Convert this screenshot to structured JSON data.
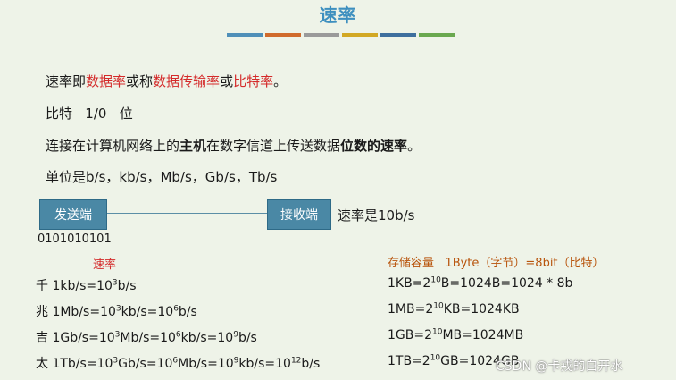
{
  "slide": {
    "title": "速率",
    "title_bar_colors": [
      "#4f8fb8",
      "#d06a2c",
      "#9a9a9a",
      "#d2a824",
      "#3e6f9e",
      "#6aa84f"
    ]
  },
  "intro": {
    "p1": [
      "速率即",
      "数据率",
      "或称",
      "数据传输率",
      "或",
      "比特率",
      "。"
    ],
    "p2": "比特   1/0   位",
    "p3": [
      "连接在计算机网络上的",
      "主机",
      "在数字信道上传送数据",
      "位数的速率",
      "。"
    ],
    "p4": "单位是b/s，kb/s，Mb/s，Gb/s，Tb/s"
  },
  "diagram": {
    "sender": "发送端",
    "receiver": "接收端",
    "rate_text": "速率是10b/s",
    "bits": "0101010101"
  },
  "rate_col": {
    "header": "速率",
    "rows": [
      [
        "千 1kb/s=10",
        "3",
        "b/s"
      ],
      [
        "兆 1Mb/s=10",
        "3",
        "kb/s=10",
        "6",
        "b/s"
      ],
      [
        "吉 1Gb/s=10",
        "3",
        "Mb/s=10",
        "6",
        "kb/s=10",
        "9",
        "b/s"
      ],
      [
        "太 1Tb/s=10",
        "3",
        "Gb/s=10",
        "6",
        "Mb/s=10",
        "9",
        "kb/s=10",
        "12",
        "b/s"
      ]
    ]
  },
  "storage_col": {
    "header": "存储容量",
    "header_note": "1Byte（字节）=8bit（比特）",
    "rows": [
      [
        "1KB=2",
        "10",
        "B=1024B=1024 * 8b"
      ],
      [
        "1MB=2",
        "10",
        "KB=1024KB"
      ],
      [
        "1GB=2",
        "10",
        "MB=1024MB"
      ],
      [
        "1TB=2",
        "10",
        "GB=1024GB"
      ]
    ]
  },
  "watermark": "CSDN @卡戎的白开水"
}
